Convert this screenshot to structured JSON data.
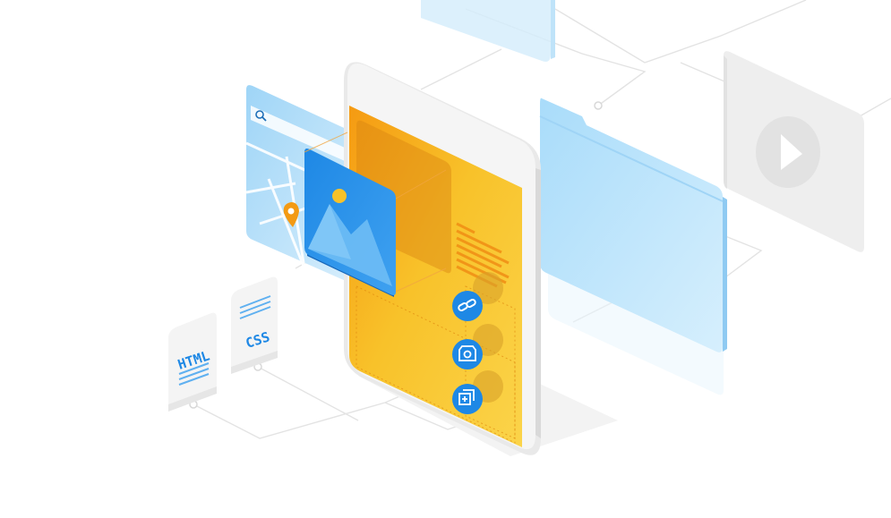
{
  "illustration": {
    "colors": {
      "accent_blue": "#1e88e5",
      "light_blue": "#b9e3fb",
      "yellow": "#f8c22a",
      "orange": "#f4a41f",
      "gray": "#e7e7e7"
    },
    "cards": {
      "html_label": "HTML",
      "css_label": "CSS"
    },
    "icons": [
      "search-icon",
      "map-pin-icon",
      "image-icon",
      "link-icon",
      "camera-switch-icon",
      "add-layer-icon",
      "play-icon",
      "folder-icon"
    ]
  }
}
